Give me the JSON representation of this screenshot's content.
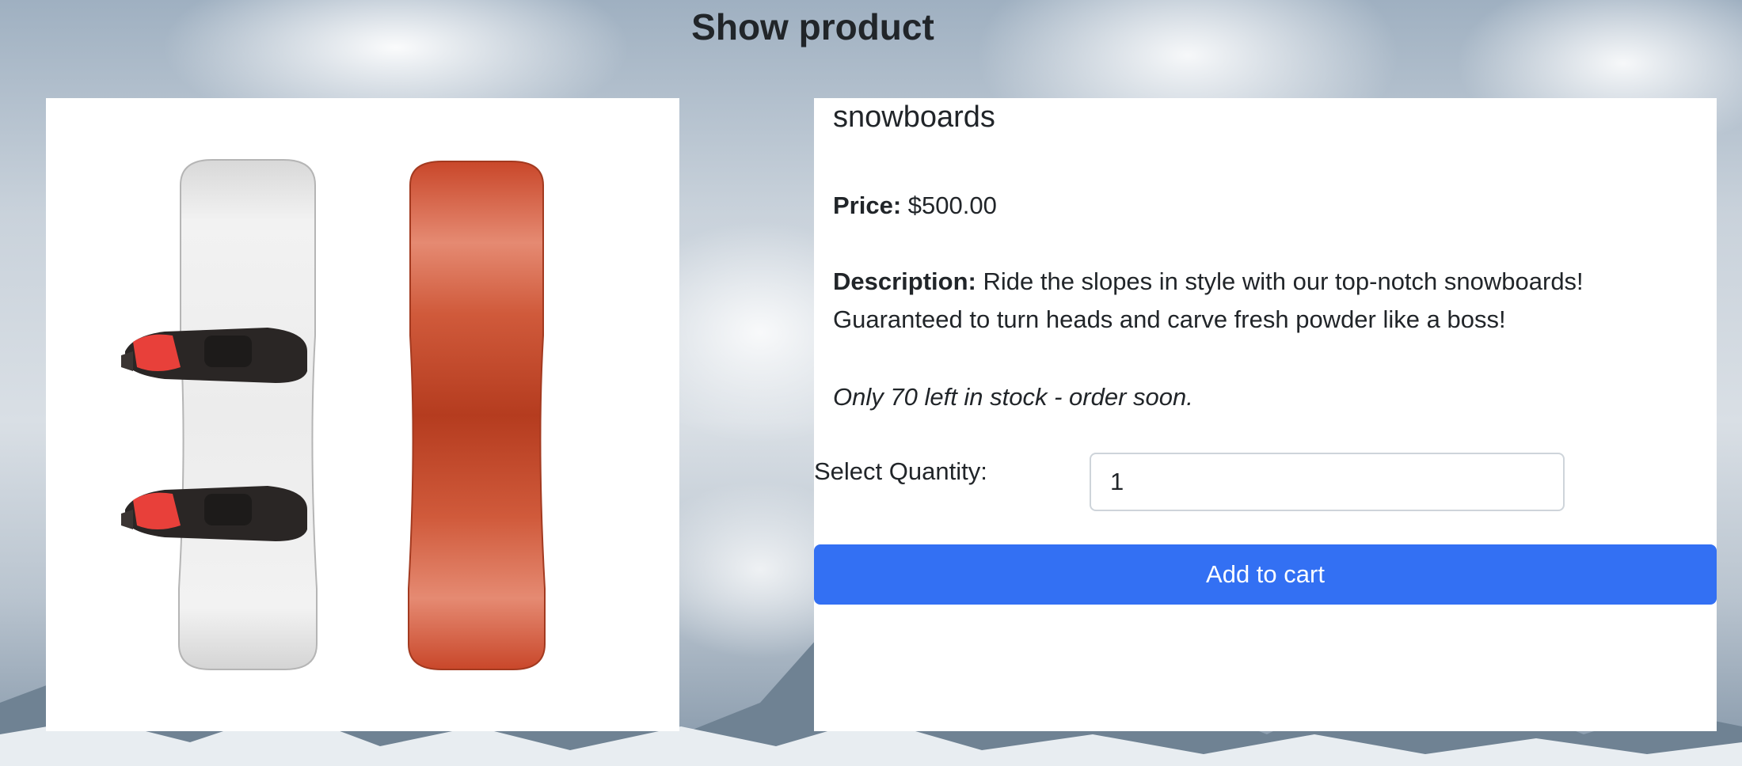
{
  "page": {
    "title": "Show product"
  },
  "product": {
    "name": "snowboards",
    "image_alt": "snowboard-image",
    "price_label": "Price:",
    "price_value": "$500.00",
    "description_label": "Description:",
    "description_value": "Ride the slopes in style with our top-notch snowboards! Guaranteed to turn heads and carve fresh powder like a boss!",
    "stock_text": "Only 70 left in stock - order soon."
  },
  "cart": {
    "quantity_label": "Select Quantity:",
    "quantity_value": "1",
    "add_button_label": "Add to cart"
  },
  "colors": {
    "accent": "#3370f3",
    "board_orange": "#c9472a",
    "binding_red": "#e8403a"
  }
}
